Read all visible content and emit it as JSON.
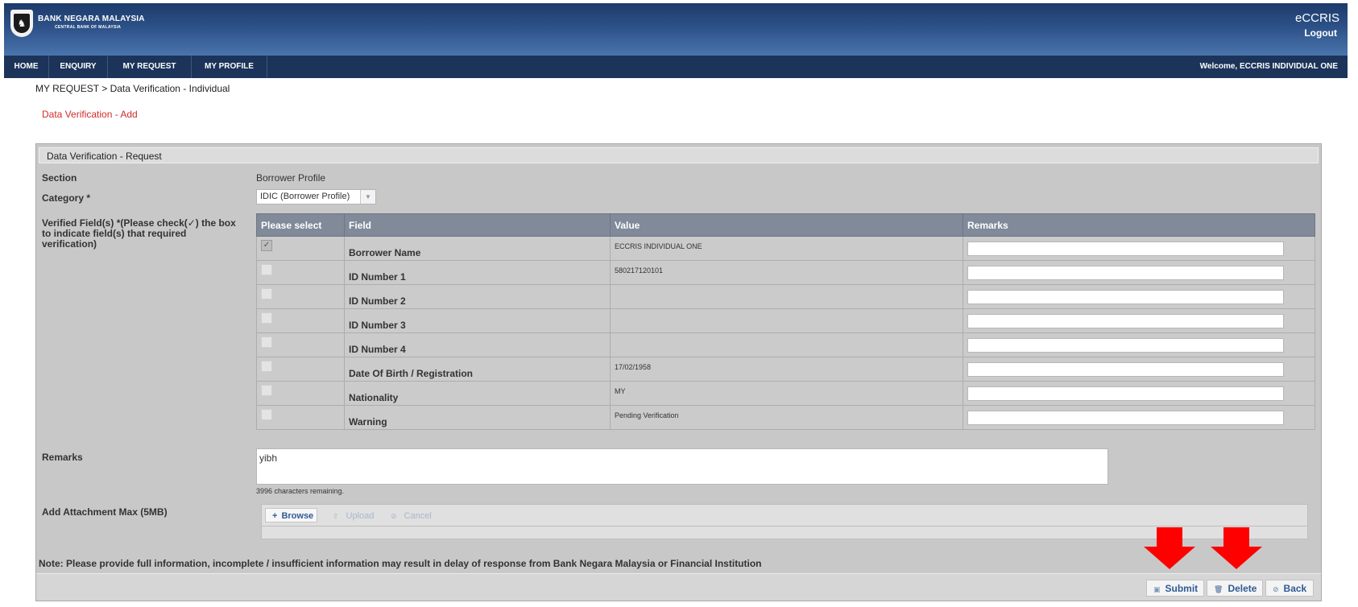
{
  "header": {
    "bank_name": "BANK NEGARA MALAYSIA",
    "bank_subtitle": "CENTRAL BANK OF MALAYSIA",
    "app_title": "eCCRIS",
    "logout": "Logout"
  },
  "nav": {
    "items": [
      {
        "label": "HOME"
      },
      {
        "label": "ENQUIRY"
      },
      {
        "label": "MY REQUEST"
      },
      {
        "label": "MY PROFILE"
      }
    ],
    "welcome": "Welcome, ECCRIS INDIVIDUAL ONE"
  },
  "breadcrumb": "MY REQUEST > Data Verification - Individual",
  "page_subtitle": "Data Verification - Add",
  "panel": {
    "title": "Data Verification - Request",
    "section_label": "Section",
    "section_value": "Borrower Profile",
    "category_label": "Category *",
    "category_value": "IDIC (Borrower Profile)",
    "verified_label": "Verified Field(s) *(Please check(✓) the box to indicate field(s) that required verification)",
    "table": {
      "headers": [
        "Please select",
        "Field",
        "Value",
        "Remarks"
      ],
      "rows": [
        {
          "field": "Borrower Name",
          "value": "ECCRIS INDIVIDUAL ONE",
          "checked": true
        },
        {
          "field": "ID Number 1",
          "value": "580217120101",
          "checked": false
        },
        {
          "field": "ID Number 2",
          "value": "",
          "checked": false
        },
        {
          "field": "ID Number 3",
          "value": "",
          "checked": false
        },
        {
          "field": "ID Number 4",
          "value": "",
          "checked": false
        },
        {
          "field": "Date Of Birth / Registration",
          "value": "17/02/1958",
          "checked": false
        },
        {
          "field": "Nationality",
          "value": "MY",
          "checked": false
        },
        {
          "field": "Warning",
          "value": "Pending Verification",
          "checked": false
        }
      ]
    },
    "remarks_label": "Remarks",
    "remarks_value": "yibh",
    "chars_remaining": "3996 characters remaining.",
    "attachment_label": "Add Attachment Max (5MB)",
    "attach_buttons": {
      "browse": "Browse",
      "upload": "Upload",
      "cancel": "Cancel"
    },
    "note": "Note: Please provide full information, incomplete / insufficient information may result in delay of response from Bank Negara Malaysia or Financial Institution",
    "buttons": {
      "submit": "Submit",
      "delete": "Delete",
      "back": "Back"
    }
  },
  "colors": {
    "arrow": "#ff0000",
    "header_top": "#1d3a6a",
    "navbar": "#1c3459",
    "subtitle_red": "#d12b2b"
  }
}
